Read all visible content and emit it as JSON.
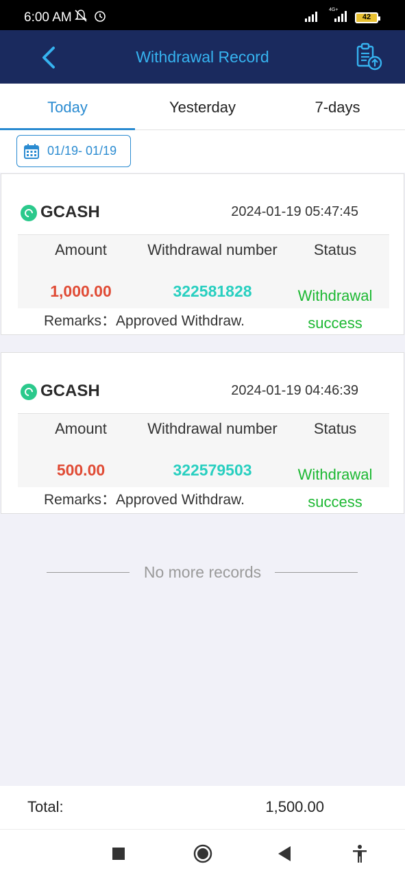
{
  "status_bar": {
    "time": "6:00 AM",
    "network": "4G+",
    "battery": "42"
  },
  "header": {
    "title": "Withdrawal Record"
  },
  "tabs": [
    {
      "label": "Today",
      "active": true
    },
    {
      "label": "Yesterday",
      "active": false
    },
    {
      "label": "7-days",
      "active": false
    }
  ],
  "date_filter": {
    "label": "01/19- 01/19"
  },
  "columns": {
    "amount": "Amount",
    "number": "Withdrawal number",
    "status": "Status"
  },
  "records": [
    {
      "method": "GCASH",
      "datetime": "2024-01-19 05:47:45",
      "amount": "1,000.00",
      "number": "322581828",
      "status_line1": "Withdrawal",
      "status_line2": "success",
      "remarks": "Remarks：Approved Withdraw."
    },
    {
      "method": "GCASH",
      "datetime": "2024-01-19 04:46:39",
      "amount": "500.00",
      "number": "322579503",
      "status_line1": "Withdrawal",
      "status_line2": "success",
      "remarks": "Remarks：Approved Withdraw."
    }
  ],
  "list_end_text": "No more records",
  "footer": {
    "total_label": "Total:",
    "total_value": "1,500.00"
  },
  "colors": {
    "header_bg": "#1a2a5e",
    "accent": "#2a8bd1",
    "amount": "#e04b35",
    "number": "#28cfc0",
    "success": "#1cb832"
  }
}
